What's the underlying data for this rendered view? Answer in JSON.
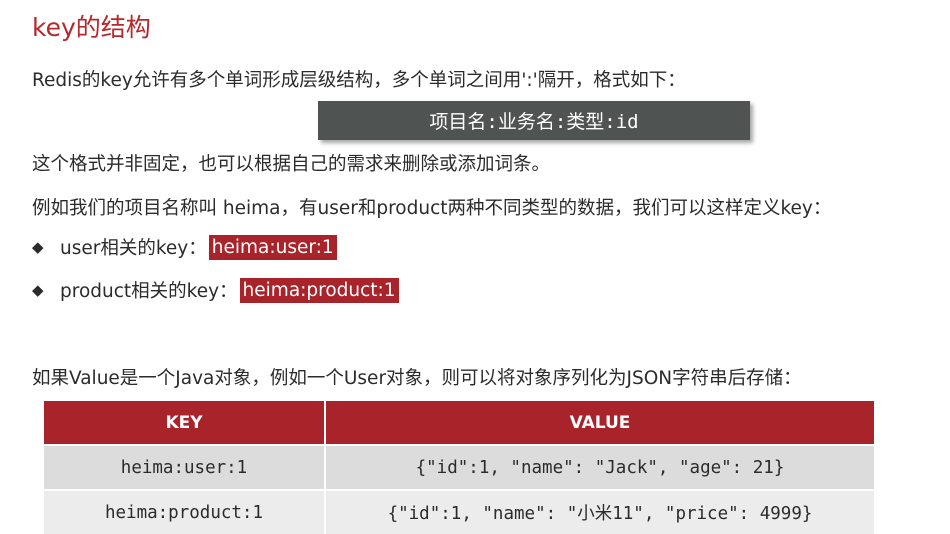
{
  "title": "key的结构",
  "intro": "Redis的key允许有多个单词形成层级结构，多个单词之间用':'隔开，格式如下：",
  "format": "项目名:业务名:类型:id",
  "note": "这个格式并非固定，也可以根据自己的需求来删除或添加词条。",
  "example_intro": "例如我们的项目名称叫 heima，有user和product两种不同类型的数据，我们可以这样定义key：",
  "bullets": [
    {
      "label": "user相关的key：",
      "key": "heima:user:1"
    },
    {
      "label": "product相关的key：",
      "key": "heima:product:1"
    }
  ],
  "value_intro": "如果Value是一个Java对象，例如一个User对象，则可以将对象序列化为JSON字符串后存储：",
  "table": {
    "headers": [
      "KEY",
      "VALUE"
    ],
    "rows": [
      [
        "heima:user:1",
        "{\"id\":1, \"name\": \"Jack\", \"age\": 21}"
      ],
      [
        "heima:product:1",
        "{\"id\":1, \"name\": \"小米11\", \"price\": 4999}"
      ]
    ]
  },
  "colors": {
    "accent": "#a9232a",
    "title": "#b5282b",
    "format_bg": "#4f5453"
  }
}
